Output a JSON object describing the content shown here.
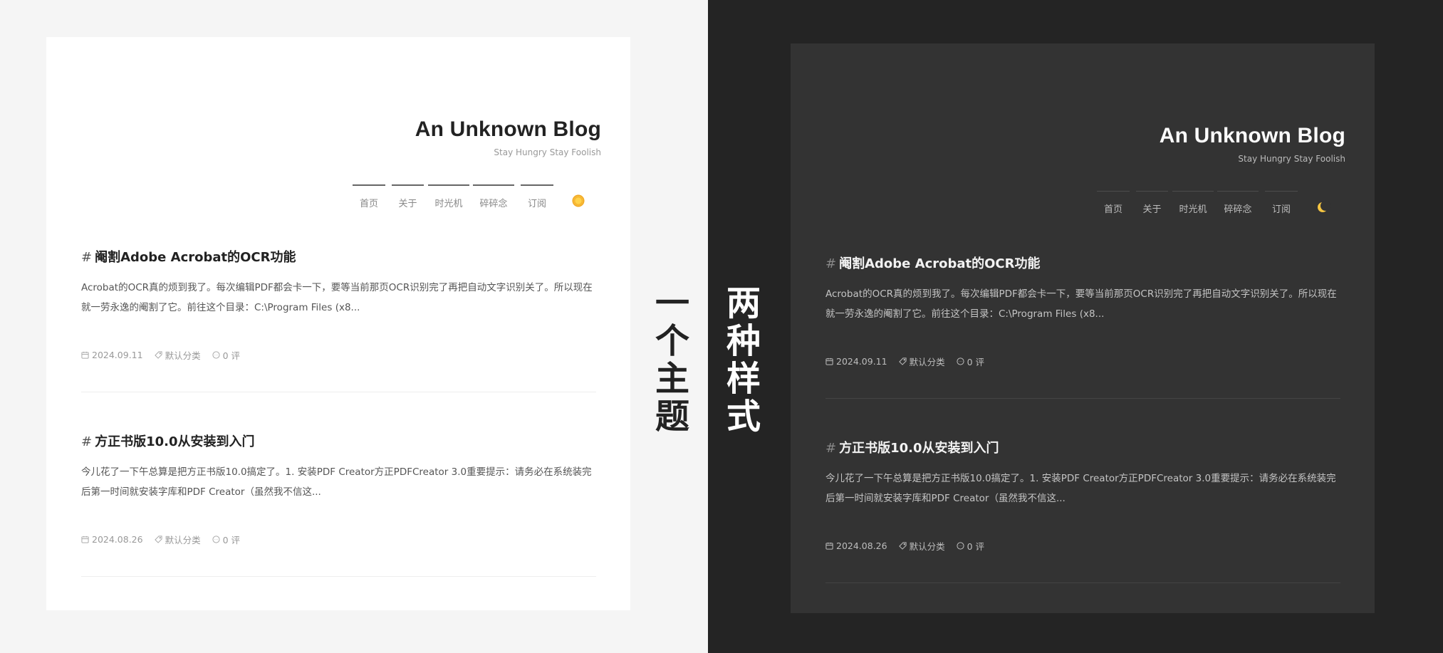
{
  "caption_left": [
    "一",
    "个",
    "主",
    "题"
  ],
  "caption_right": [
    "两",
    "种",
    "样",
    "式"
  ],
  "blog": {
    "title": "An Unknown Blog",
    "subtitle": "Stay Hungry Stay Foolish",
    "nav": [
      "首页",
      "关于",
      "时光机",
      "碎碎念",
      "订阅"
    ]
  },
  "posts": [
    {
      "hash": "#",
      "title": "阉割Adobe Acrobat的OCR功能",
      "excerpt": "Acrobat的OCR真的烦到我了。每次编辑PDF都会卡一下，要等当前那页OCR识别完了再把自动文字识别关了。所以现在就一劳永逸的阉割了它。前往这个目录：C:\\Program Files (x8...",
      "date": "2024.09.11",
      "category": "默认分类",
      "comments": "0 评"
    },
    {
      "hash": "#",
      "title": "方正书版10.0从安装到入门",
      "excerpt": "今儿花了一下午总算是把方正书版10.0搞定了。1. 安装PDF Creator方正PDFCreator 3.0重要提示：请务必在系统装完后第一时间就安装字库和PDF Creator（虽然我不信这...",
      "date": "2024.08.26",
      "category": "默认分类",
      "comments": "0 评"
    }
  ],
  "themes": {
    "light": {
      "background": "#ffffff",
      "page": "#f5f5f5",
      "toggle_icon": "sun-icon",
      "toggle_color": "#f7b731"
    },
    "dark": {
      "background": "#333333",
      "page": "#242424",
      "toggle_icon": "moon-icon",
      "toggle_color": "#f5c542"
    }
  }
}
